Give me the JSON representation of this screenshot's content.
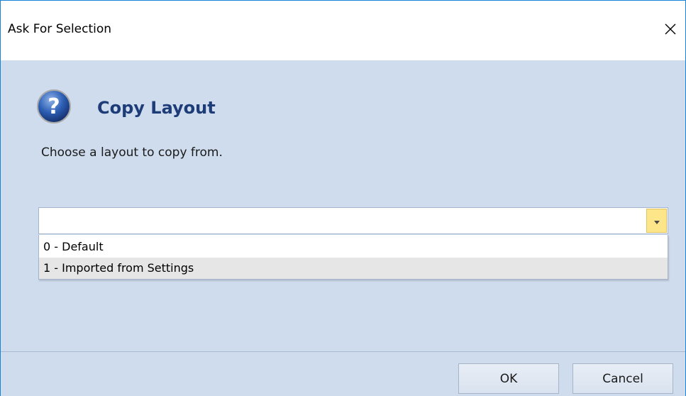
{
  "window": {
    "title": "Ask For Selection"
  },
  "dialog": {
    "heading": "Copy Layout",
    "prompt": "Choose a layout to copy from.",
    "icon": "question-icon"
  },
  "combo": {
    "value": "",
    "options": [
      {
        "label": "0 - Default"
      },
      {
        "label": "1 - Imported from Settings"
      }
    ],
    "highlighted_index": 1
  },
  "buttons": {
    "ok_label": "OK",
    "cancel_label": "Cancel"
  },
  "colors": {
    "window_border": "#1883d7",
    "body_background": "#cfdcee",
    "heading_text": "#1d3c78",
    "dropdown_button": "#fde58a",
    "highlight_row": "#e6e6e6"
  }
}
